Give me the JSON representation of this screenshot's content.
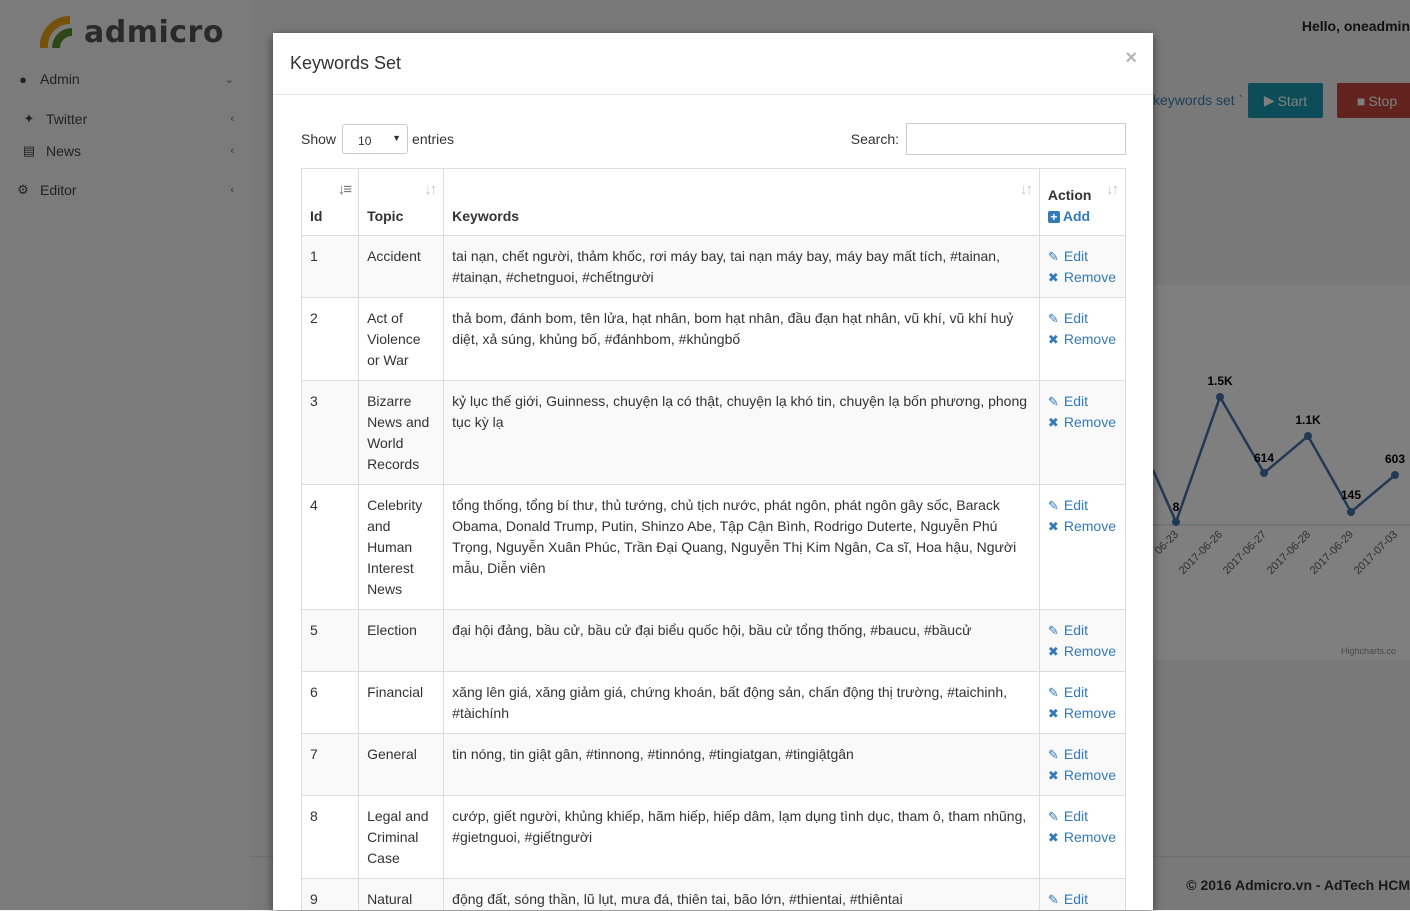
{
  "app": {
    "logo_text": "admicro",
    "greeting": "Hello, oneadmin",
    "footer": "© 2016 Admicro.vn - AdTech HCM"
  },
  "sidebar": {
    "items": [
      {
        "label": "Admin",
        "icon": "user-icon"
      },
      {
        "label": "Twitter",
        "icon": "twitter-icon"
      },
      {
        "label": "News",
        "icon": "newspaper-icon"
      },
      {
        "label": "Editor",
        "icon": "gears-icon"
      }
    ]
  },
  "toolbar": {
    "keywords_link": "keywords set `",
    "start_label": "Start",
    "stop_label": "Stop"
  },
  "chart": {
    "point_labels": [
      "8",
      "1.5K",
      "614",
      "1.1K",
      "145",
      "603"
    ],
    "x_labels": [
      "06-23",
      "2017-06-26",
      "2017-06-27",
      "2017-06-28",
      "2017-06-29",
      "2017-07-03"
    ],
    "credits": "Highcharts.co"
  },
  "modal": {
    "title": "Keywords Set",
    "close_label": "×",
    "show_label": "Show",
    "entries_value": "10",
    "entries_label": "entries",
    "search_label": "Search:",
    "search_value": "",
    "columns": {
      "id": "Id",
      "topic": "Topic",
      "keywords": "Keywords",
      "action": "Action",
      "add": "Add"
    },
    "edit_label": "Edit",
    "remove_label": "Remove",
    "rows": [
      {
        "id": "1",
        "topic": "Accident",
        "keywords": "tai nạn, chết người, thảm khốc, rơi máy bay, tai nạn máy bay, máy bay mất tích, #tainan, #tainạn, #chetnguoi, #chếtngười"
      },
      {
        "id": "2",
        "topic": "Act of Violence or War",
        "keywords": "thả bom, đánh bom, tên lửa, hạt nhân, bom hạt nhân, đầu đạn hạt nhân, vũ khí, vũ khí huỷ diệt, xả súng, khủng bố, #đánhbom, #khủngbố"
      },
      {
        "id": "3",
        "topic": "Bizarre News and World Records",
        "keywords": "kỷ lục thế giới, Guinness, chuyện lạ có thật, chuyện lạ khó tin, chuyện lạ bốn phương, phong tục kỳ lạ"
      },
      {
        "id": "4",
        "topic": "Celebrity and Human Interest News",
        "keywords": "tổng thống, tổng bí thư, thủ tướng, chủ tịch nước, phát ngôn, phát ngôn gây sốc, Barack Obama, Donald Trump, Putin, Shinzo Abe, Tập Cận Bình, Rodrigo Duterte, Nguyễn Phú Trọng, Nguyễn Xuân Phúc, Trần Đại Quang, Nguyễn Thị Kim Ngân, Ca sĩ, Hoa hậu, Người mẫu, Diễn viên"
      },
      {
        "id": "5",
        "topic": "Election",
        "keywords": "đại hội đảng, bầu cử, bầu cử đại biểu quốc hội, bầu cử tổng thống, #baucu, #bầucử"
      },
      {
        "id": "6",
        "topic": "Financial",
        "keywords": "xăng lên giá, xăng giảm giá, chứng khoán, bất động sản, chấn động thị trường, #taichinh, #tàichính"
      },
      {
        "id": "7",
        "topic": "General",
        "keywords": "tin nóng, tin giật gân, #tinnong, #tinnóng, #tingiatgan, #tingiậtgân"
      },
      {
        "id": "8",
        "topic": "Legal and Criminal Case",
        "keywords": "cướp, giết người, khủng khiếp, hãm hiếp, hiếp dâm, lạm dụng tình dục, tham ô, tham nhũng, #gietnguoi, #giếtngười"
      },
      {
        "id": "9",
        "topic": "Natural Disaster",
        "keywords": "động đất, sóng thần, lũ lụt, mưa đá, thiên tai, bão lớn, #thientai, #thiêntai"
      }
    ]
  }
}
